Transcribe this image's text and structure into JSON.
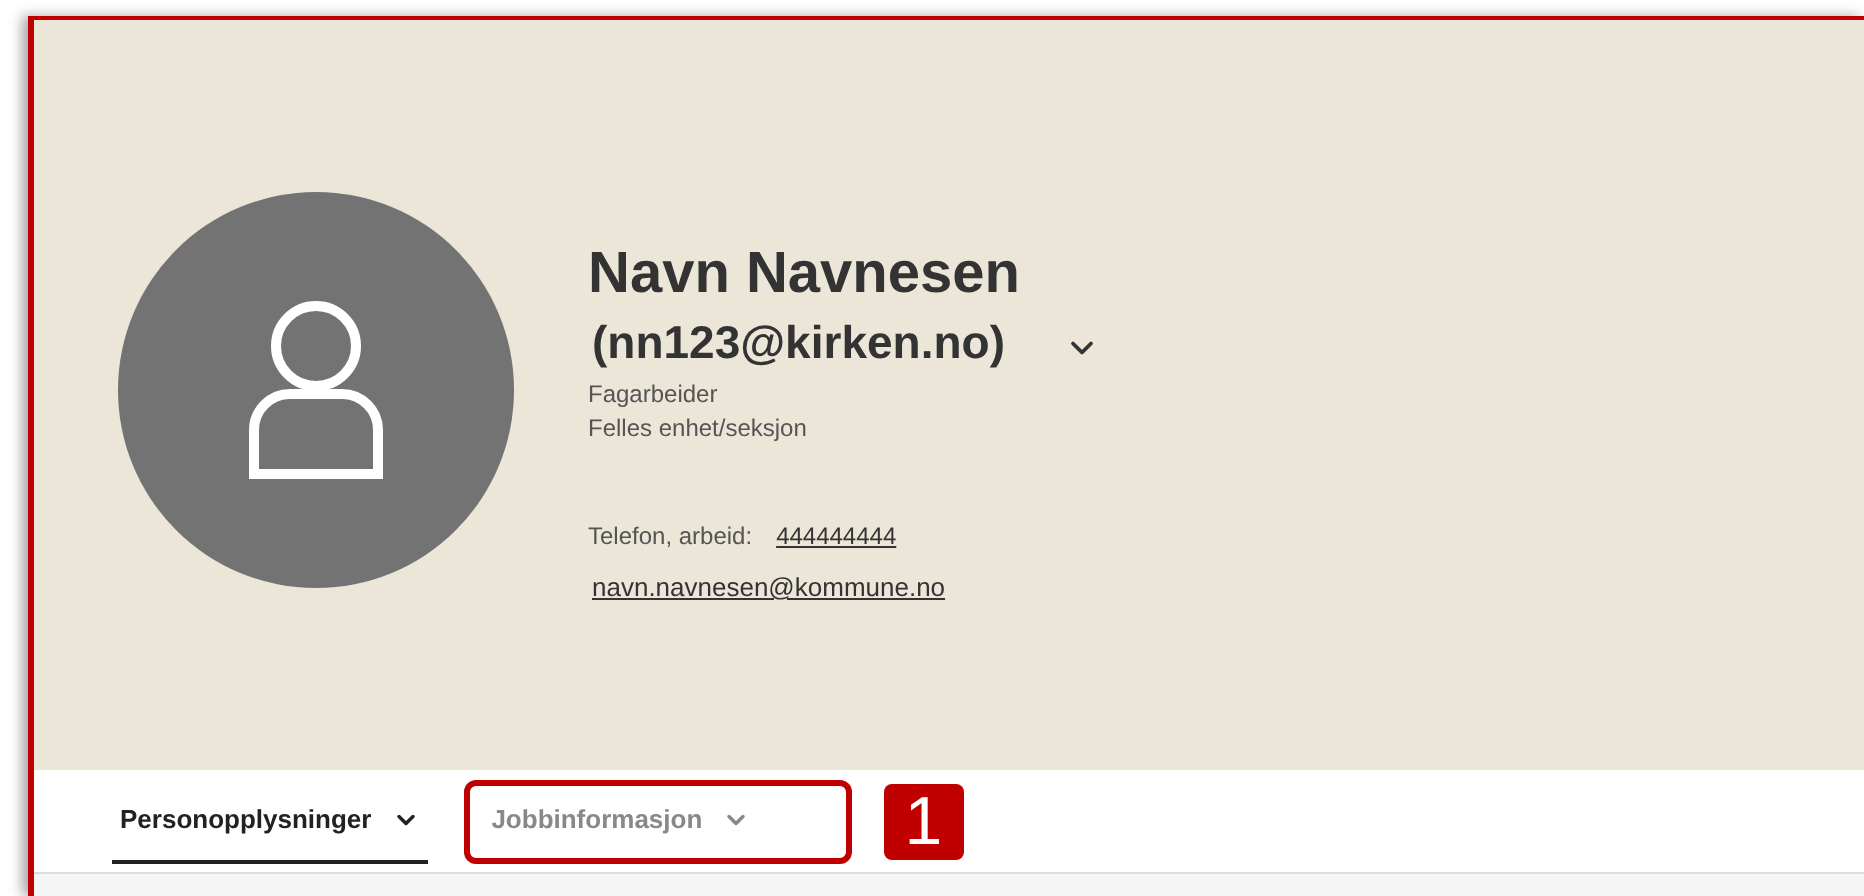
{
  "profile": {
    "name": "Navn Navnesen",
    "username": "(nn123@kirken.no)",
    "job_title": "Fagarbeider",
    "unit": "Felles enhet/seksjon",
    "phone_label": "Telefon, arbeid:",
    "phone": "444444444",
    "email": "navn.navnesen@kommune.no"
  },
  "tabs": [
    {
      "label": "Personopplysninger",
      "selected": true,
      "highlighted": false
    },
    {
      "label": "Jobbinformasjon",
      "selected": false,
      "highlighted": true
    }
  ],
  "callout": {
    "label": "1"
  }
}
